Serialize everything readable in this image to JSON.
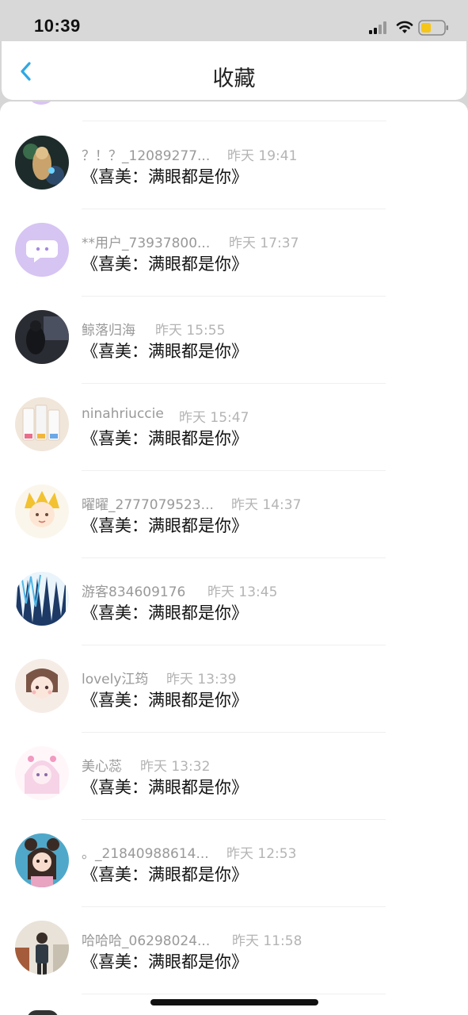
{
  "status_bar": {
    "time": "10:39"
  },
  "nav": {
    "title": "收藏",
    "back_icon": "chevron-left-icon"
  },
  "favorites": [
    {
      "user": "？！？_12089277...",
      "time": "昨天 19:41",
      "title": "《喜美：满眼都是你》"
    },
    {
      "user": "**用户_73937800...",
      "time": "昨天 17:37",
      "title": "《喜美：满眼都是你》"
    },
    {
      "user": "鲸落归海",
      "time": "昨天 15:55",
      "title": "《喜美：满眼都是你》"
    },
    {
      "user": "ninahriuccie",
      "time": "昨天 15:47",
      "title": "《喜美：满眼都是你》"
    },
    {
      "user": "曜曜_2777079523...",
      "time": "昨天 14:37",
      "title": "《喜美：满眼都是你》"
    },
    {
      "user": "游客834609176",
      "time": "昨天 13:45",
      "title": "《喜美：满眼都是你》"
    },
    {
      "user": "lovely江筠",
      "time": "昨天 13:39",
      "title": "《喜美：满眼都是你》"
    },
    {
      "user": "美心蕊",
      "time": "昨天 13:32",
      "title": "《喜美：满眼都是你》"
    },
    {
      "user": "。_21840988614...",
      "time": "昨天 12:53",
      "title": "《喜美：满眼都是你》"
    },
    {
      "user": "哈哈哈_06298024...",
      "time": "昨天 11:58",
      "title": "《喜美：满眼都是你》"
    }
  ],
  "colors": {
    "accent": "#2ea8e6",
    "username": "#999999",
    "timestamp": "#b4b4b4",
    "title": "#111111"
  }
}
